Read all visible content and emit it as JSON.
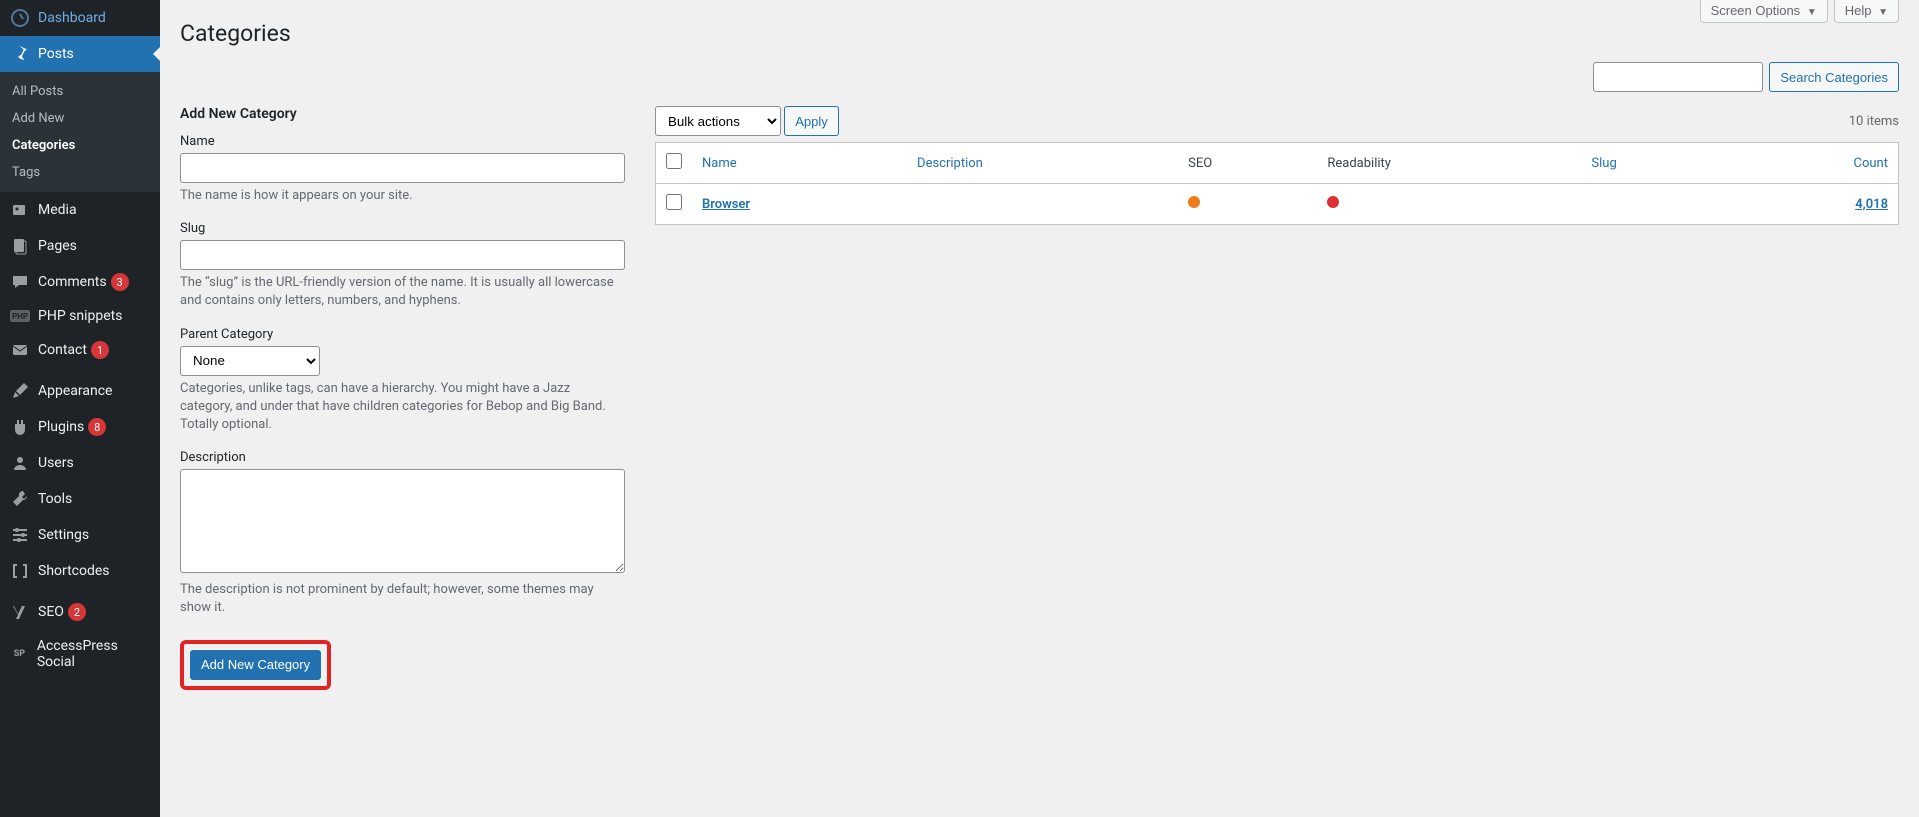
{
  "sidebar": {
    "dashboard": "Dashboard",
    "posts": "Posts",
    "posts_sub": {
      "all": "All Posts",
      "add": "Add New",
      "categories": "Categories",
      "tags": "Tags"
    },
    "media": "Media",
    "pages": "Pages",
    "comments": "Comments",
    "comments_badge": "3",
    "php_snippets": "PHP snippets",
    "contact": "Contact",
    "contact_badge": "1",
    "appearance": "Appearance",
    "plugins": "Plugins",
    "plugins_badge": "8",
    "users": "Users",
    "tools": "Tools",
    "settings": "Settings",
    "shortcodes": "Shortcodes",
    "seo": "SEO",
    "seo_badge": "2",
    "accesspress": "AccessPress Social"
  },
  "top": {
    "screen_options": "Screen Options",
    "help": "Help"
  },
  "page_title": "Categories",
  "search": {
    "button": "Search Categories"
  },
  "form": {
    "title": "Add New Category",
    "name_label": "Name",
    "name_help": "The name is how it appears on your site.",
    "slug_label": "Slug",
    "slug_help": "The “slug” is the URL-friendly version of the name. It is usually all lowercase and contains only letters, numbers, and hyphens.",
    "parent_label": "Parent Category",
    "parent_value": "None",
    "parent_help": "Categories, unlike tags, can have a hierarchy. You might have a Jazz category, and under that have children categories for Bebop and Big Band. Totally optional.",
    "desc_label": "Description",
    "desc_help": "The description is not prominent by default; however, some themes may show it.",
    "submit": "Add New Category"
  },
  "list": {
    "bulk_label": "Bulk actions",
    "apply": "Apply",
    "items_count": "10 items",
    "cols": {
      "name": "Name",
      "description": "Description",
      "seo": "SEO",
      "readability": "Readability",
      "slug": "Slug",
      "count": "Count"
    },
    "rows": [
      {
        "name": "Browser",
        "count": "4,018",
        "seo": "orange",
        "readability": "red"
      }
    ]
  }
}
